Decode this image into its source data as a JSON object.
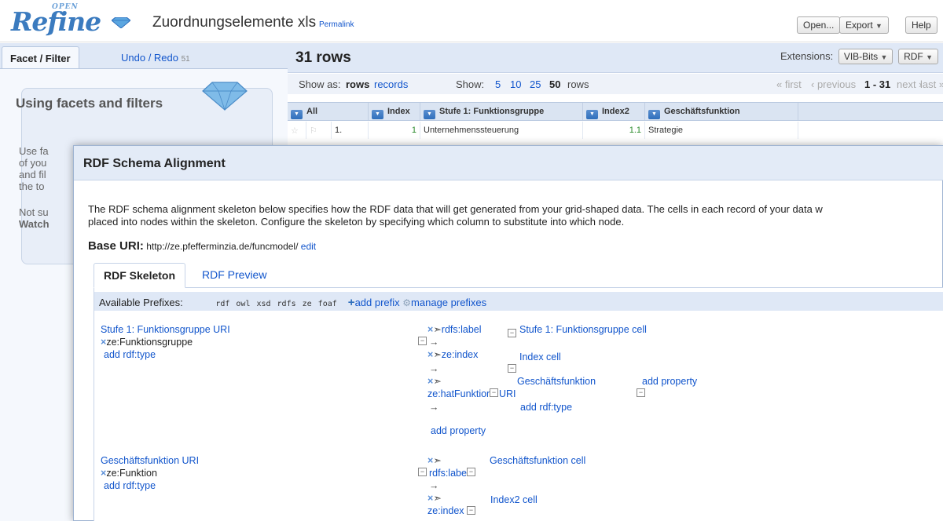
{
  "header": {
    "logo_text": "Refine",
    "logo_open": "OPEN",
    "project_title": "Zuordnungselemente xls",
    "permalink": "Permalink",
    "buttons": {
      "open": "Open...",
      "export": "Export",
      "help": "Help"
    }
  },
  "left_panel": {
    "tabs": {
      "facet_filter": "Facet / Filter",
      "undo_redo": "Undo / Redo",
      "undo_count": "51"
    },
    "help_box": {
      "title": "Using facets and filters",
      "lines": [
        "Use fa",
        "of you",
        "and fil",
        "the to"
      ],
      "not_sure": "Not su",
      "watch": "Watch"
    }
  },
  "data_area": {
    "rows_count": "31 rows",
    "extensions_label": "Extensions:",
    "extensions": [
      "VIB-Bits",
      "RDF"
    ],
    "show_as_label": "Show as:",
    "show_as_rows": "rows",
    "show_as_records": "records",
    "show_label": "Show:",
    "page_sizes": [
      "5",
      "10",
      "25",
      "50"
    ],
    "page_size_selected": "50",
    "rows_suffix": "rows",
    "pagination": {
      "first": "« first",
      "previous": "‹ previous",
      "range": "1 - 31",
      "next": "next ›",
      "last": "last »"
    },
    "columns": [
      "All",
      "Index",
      "Stufe 1: Funktionsgruppe",
      "Index2",
      "Geschäftsfunktion"
    ],
    "row1": {
      "num": "1.",
      "index": "1",
      "funktionsgruppe": "Unternehmenssteuerung",
      "index2": "1.1",
      "funktion": "Strategie"
    }
  },
  "dialog": {
    "title": "RDF Schema Alignment",
    "description_line1": "The RDF schema alignment skeleton below specifies how the RDF data that will get generated from your grid-shaped data. The cells in each record of your data w",
    "description_line2": "placed into nodes within the skeleton. Configure the skeleton by specifying which column to substitute into which node.",
    "base_uri_label": "Base URI:",
    "base_uri": "http://ze.pfefferminzia.de/funcmodel/",
    "edit": "edit",
    "tabs": {
      "skeleton": "RDF Skeleton",
      "preview": "RDF Preview"
    },
    "prefix_bar": {
      "label": "Available Prefixes:",
      "prefixes": [
        "rdf",
        "owl",
        "xsd",
        "rdfs",
        "ze",
        "foaf"
      ],
      "add_prefix": "add prefix",
      "manage_prefixes": "manage prefixes"
    },
    "skeleton": {
      "node1": {
        "title": "Stufe 1: Funktionsgruppe URI",
        "type": "ze:Funktionsgruppe",
        "add_type": "add rdf:type"
      },
      "node1_props": {
        "p1": {
          "name": "rdfs:label",
          "target": "Stufe 1: Funktionsgruppe cell"
        },
        "p2": {
          "name": "ze:index",
          "target": "Index cell"
        },
        "p3": {
          "name_a": "ze:hatFunktion",
          "target_a": "Geschäftsfunktion",
          "target_b": "URI",
          "add_type": "add rdf:type",
          "add_property": "add property"
        }
      },
      "add_property": "add property",
      "node2": {
        "title": "Geschäftsfunktion URI",
        "type": "ze:Funktion",
        "add_type": "add rdf:type"
      },
      "node2_props": {
        "p1": {
          "name": "rdfs:label",
          "target": "Geschäftsfunktion cell"
        },
        "p2": {
          "name": "ze:index",
          "target": "Index2 cell"
        }
      }
    }
  }
}
